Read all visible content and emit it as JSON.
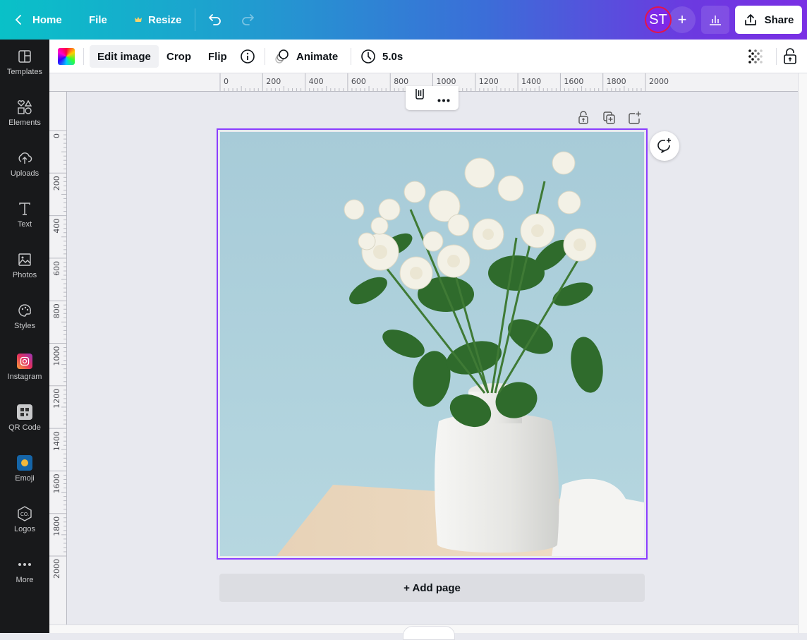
{
  "topbar": {
    "home_label": "Home",
    "file_label": "File",
    "resize_label": "Resize",
    "avatar_initials": "ST",
    "share_label": "Share",
    "gradient_start": "#09c1c8",
    "gradient_end": "#7a2fe4"
  },
  "context_toolbar": {
    "edit_image_label": "Edit image",
    "crop_label": "Crop",
    "flip_label": "Flip",
    "animate_label": "Animate",
    "duration_label": "5.0s"
  },
  "sidebar": {
    "items": [
      {
        "label": "Templates",
        "icon": "templates-icon"
      },
      {
        "label": "Elements",
        "icon": "elements-icon"
      },
      {
        "label": "Uploads",
        "icon": "uploads-icon"
      },
      {
        "label": "Text",
        "icon": "text-icon"
      },
      {
        "label": "Photos",
        "icon": "photos-icon"
      },
      {
        "label": "Styles",
        "icon": "styles-icon"
      },
      {
        "label": "Instagram",
        "icon": "instagram-icon"
      },
      {
        "label": "QR Code",
        "icon": "qr-code-icon"
      },
      {
        "label": "Emoji",
        "icon": "emoji-icon"
      },
      {
        "label": "Logos",
        "icon": "logos-icon"
      },
      {
        "label": "More",
        "icon": "more-icon"
      }
    ]
  },
  "rulers": {
    "horizontal_ticks": [
      "0",
      "200",
      "400",
      "600",
      "800",
      "1000",
      "1200",
      "1400",
      "1600",
      "1800",
      "2000"
    ],
    "vertical_ticks": [
      "0",
      "200",
      "400",
      "600",
      "800",
      "1000",
      "1200",
      "1400",
      "1600",
      "1800",
      "2000"
    ]
  },
  "canvas": {
    "image_description": "White roses bouquet in white ceramic vase on wooden table against light blue wall",
    "selection_color": "#8b3dff"
  },
  "add_page_label": "+ Add page"
}
